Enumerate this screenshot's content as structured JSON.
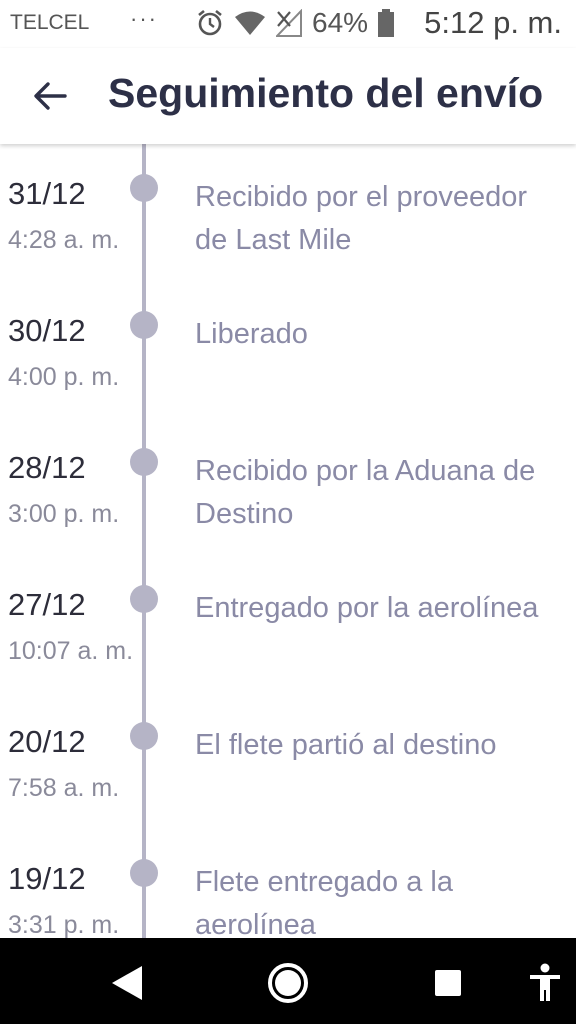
{
  "status_bar": {
    "carrier": "TELCEL",
    "dots": "···",
    "battery_pct": "64%",
    "time": "5:12 p. m."
  },
  "app_bar": {
    "title": "Seguimiento del envío"
  },
  "events": [
    {
      "date": "31/12",
      "time": "4:28 a. m.",
      "description": "Recibido por el proveedor de Last Mile"
    },
    {
      "date": "30/12",
      "time": "4:00 p. m.",
      "description": "Liberado"
    },
    {
      "date": "28/12",
      "time": "3:00 p. m.",
      "description": "Recibido por la Aduana de Destino"
    },
    {
      "date": "27/12",
      "time": "10:07 a. m.",
      "description": "Entregado por la aerolínea"
    },
    {
      "date": "20/12",
      "time": "7:58 a. m.",
      "description": "El flete partió al destino"
    },
    {
      "date": "19/12",
      "time": "3:31 p. m.",
      "description": "Flete entregado a la aerolínea"
    }
  ],
  "colors": {
    "title": "#2d3047",
    "timeline": "#b5b4c6",
    "description": "#8a8aa6"
  },
  "icons": {
    "back": "arrow-left-icon",
    "alarm": "alarm-icon",
    "wifi": "wifi-icon",
    "signal": "signal-icon",
    "battery": "battery-icon",
    "nav_back": "triangle-back-icon",
    "nav_home": "circle-home-icon",
    "nav_recents": "square-recents-icon",
    "accessibility": "accessibility-icon"
  }
}
